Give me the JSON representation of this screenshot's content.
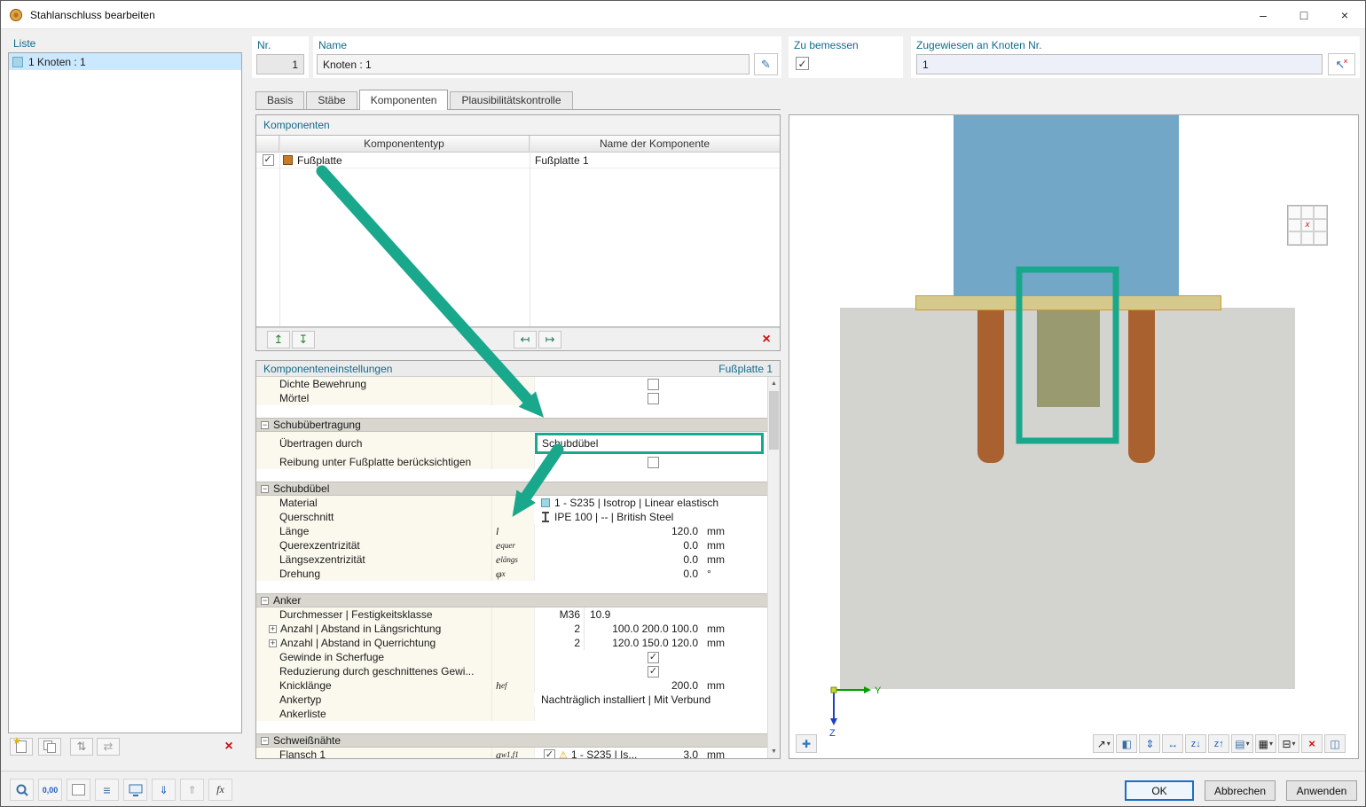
{
  "titlebar": {
    "title": "Stahlanschluss bearbeiten"
  },
  "icons": {
    "minimize": "–",
    "maximize": "□",
    "close": "×",
    "check": "✓",
    "caret": "▾",
    "scroll_up": "▲",
    "scroll_down": "▼",
    "delete": "×",
    "pencil": "✎",
    "pick": "↖",
    "pick_x": "×",
    "warning": "⚠",
    "minus": "−",
    "plus": "+",
    "star": "★",
    "pan": "✚",
    "insert_before": "↥",
    "insert_after": "↧",
    "import": "↤",
    "save": "↦",
    "renumber": "⇅",
    "swap": "⇄",
    "list": "≡",
    "transfer_down": "⇓",
    "transfer_up": "⇑",
    "fx": "fx",
    "decimal": "0,00",
    "view_dir": "↗",
    "render_mode": "◧",
    "fit_v": "⇕",
    "fit_h": "↔",
    "z_down": "z↓",
    "z_up": "z↑",
    "layers": "▤",
    "tables": "▦",
    "print": "⊟",
    "zoom_off": "×",
    "side_panel": "◫"
  },
  "liste": {
    "label": "Liste",
    "item": "1  Knoten : 1"
  },
  "header": {
    "nr_label": "Nr.",
    "nr_value": "1",
    "name_label": "Name",
    "name_value": "Knoten : 1",
    "bemessen_label": "Zu bemessen",
    "bemessen_checked": true,
    "zugewiesen_label": "Zugewiesen an Knoten Nr.",
    "zugewiesen_value": "1"
  },
  "tabs": {
    "t1": "Basis",
    "t2": "Stäbe",
    "t3": "Komponenten",
    "t4": "Plausibilitätskontrolle"
  },
  "components": {
    "title": "Komponenten",
    "col_type": "Komponententyp",
    "col_name": "Name der Komponente",
    "row_type": "Fußplatte",
    "row_name": "Fußplatte 1",
    "row_checked": true
  },
  "settings": {
    "title": "Komponenteneinstellungen",
    "context": "Fußplatte 1",
    "rows": {
      "dichte": {
        "label": "Dichte Bewehrung",
        "checked": false
      },
      "moertel": {
        "label": "Mörtel",
        "checked": false
      },
      "g_schub": {
        "label": "Schubübertragung"
      },
      "uebertragen": {
        "label": "Übertragen durch",
        "value": "Schubdübel"
      },
      "reibung": {
        "label": "Reibung unter Fußplatte berücksichtigen",
        "checked": false
      },
      "g_duebel": {
        "label": "Schubdübel"
      },
      "material": {
        "label": "Material",
        "value": "1 - S235 | Isotrop | Linear elastisch"
      },
      "querschnitt": {
        "label": "Querschnitt",
        "value": "IPE 100 | -- | British Steel"
      },
      "laenge": {
        "label": "Länge",
        "sym": "l",
        "sub": "",
        "value": "120.0",
        "unit": "mm"
      },
      "querex": {
        "label": "Querexzentrizität",
        "sym": "e",
        "sub": "quer",
        "value": "0.0",
        "unit": "mm"
      },
      "laengsex": {
        "label": "Längsexzentrizität",
        "sym": "e",
        "sub": "längs",
        "value": "0.0",
        "unit": "mm"
      },
      "drehung": {
        "label": "Drehung",
        "sym": "φ",
        "sub": "x",
        "value": "0.0",
        "unit": "°"
      },
      "g_anker": {
        "label": "Anker"
      },
      "durchmesser": {
        "label": "Durchmesser | Festigkeitsklasse",
        "v1": "M36",
        "v2": "10.9"
      },
      "anzahl_l": {
        "label": "Anzahl | Abstand in Längsrichtung",
        "v1": "2",
        "v2": "100.0 200.0 100.0",
        "unit": "mm"
      },
      "anzahl_q": {
        "label": "Anzahl | Abstand in Querrichtung",
        "v1": "2",
        "v2": "120.0 150.0 120.0",
        "unit": "mm"
      },
      "gewinde": {
        "label": "Gewinde in Scherfuge",
        "checked": true
      },
      "reduzierung": {
        "label": "Reduzierung durch geschnittenes Gewi...",
        "checked": true
      },
      "knick": {
        "label": "Knicklänge",
        "sym": "h",
        "sub": "ef",
        "value": "200.0",
        "unit": "mm"
      },
      "ankertyp": {
        "label": "Ankertyp",
        "value": "Nachträglich installiert | Mit Verbund"
      },
      "ankerliste": {
        "label": "Ankerliste"
      },
      "g_schweiss": {
        "label": "Schweißnähte"
      },
      "flansch": {
        "label": "Flansch 1",
        "sym": "a",
        "sub": "w1,f1",
        "checked": true,
        "material": "1 - S235 | Is...",
        "value": "3.0",
        "unit": "mm"
      }
    }
  },
  "viewport": {
    "axis_y": "Y",
    "axis_z": "Z",
    "cube_marker": "x"
  },
  "footer": {
    "ok": "OK",
    "cancel": "Abbrechen",
    "apply": "Anwenden"
  },
  "colors": {
    "annotation": "#1aa88c",
    "label_teal": "#116b8c",
    "steel_column": "#72a7c7",
    "base_plate": "#d6c98c",
    "concrete": "#d3d3cf",
    "anchor": "#a9612f",
    "shear_key": "#9a9a70"
  }
}
